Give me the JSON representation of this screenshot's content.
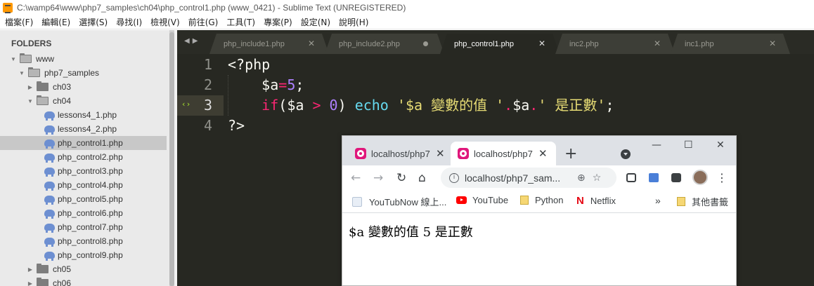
{
  "sublime": {
    "window_title": "C:\\wamp64\\www\\php7_samples\\ch04\\php_control1.php (www_0421) - Sublime Text (UNREGISTERED)",
    "menu": [
      "檔案(F)",
      "編輯(E)",
      "選擇(S)",
      "尋找(I)",
      "檢視(V)",
      "前往(G)",
      "工具(T)",
      "專案(P)",
      "設定(N)",
      "說明(H)"
    ],
    "sidebar": {
      "header": "FOLDERS",
      "items": [
        {
          "label": "www"
        },
        {
          "label": "php7_samples"
        },
        {
          "label": "ch03"
        },
        {
          "label": "ch04"
        },
        {
          "label": "lessons4_1.php"
        },
        {
          "label": "lessons4_2.php"
        },
        {
          "label": "php_control1.php"
        },
        {
          "label": "php_control2.php"
        },
        {
          "label": "php_control3.php"
        },
        {
          "label": "php_control4.php"
        },
        {
          "label": "php_control5.php"
        },
        {
          "label": "php_control6.php"
        },
        {
          "label": "php_control7.php"
        },
        {
          "label": "php_control8.php"
        },
        {
          "label": "php_control9.php"
        },
        {
          "label": "ch05"
        },
        {
          "label": "ch06"
        }
      ],
      "selected": "php_control1.php"
    },
    "tabs": [
      {
        "label": "php_include1.php"
      },
      {
        "label": "php_include2.php"
      },
      {
        "label": "php_control1.php"
      },
      {
        "label": "inc2.php"
      },
      {
        "label": "inc1.php"
      }
    ],
    "active_tab": "php_control1.php",
    "line_numbers": [
      "1",
      "2",
      "3",
      "4"
    ],
    "code": {
      "l1": "<?php",
      "l2_var": "$a",
      "l2_op": "=",
      "l2_num": "5",
      "l2_semi": ";",
      "l3_if": "if",
      "l3_open": "(",
      "l3_var": "$a",
      "l3_gt": ">",
      "l3_zero": "0",
      "l3_close": ")",
      "l3_echo": "echo",
      "l3_str1": "'$a 變數的值 '",
      "l3_dot1": ".",
      "l3_var2": "$a",
      "l3_dot2": ".",
      "l3_str2": "' 是正數'",
      "l3_semi": ";",
      "l4": "?>"
    },
    "colors": {
      "editor_bg": "#272822",
      "keyword": "#f92672",
      "string": "#e6db74",
      "number": "#ae81ff",
      "function": "#66d9ef"
    }
  },
  "chrome": {
    "tabs": [
      {
        "title": "localhost/php7"
      },
      {
        "title": "localhost/php7"
      }
    ],
    "url": "localhost/php7_sam...",
    "bookmarks": [
      "YouTubNow 線上...",
      "YouTube",
      "Python",
      "Netflix",
      "其他書籤"
    ],
    "page_text": "$a 變數的值 5 是正數"
  }
}
